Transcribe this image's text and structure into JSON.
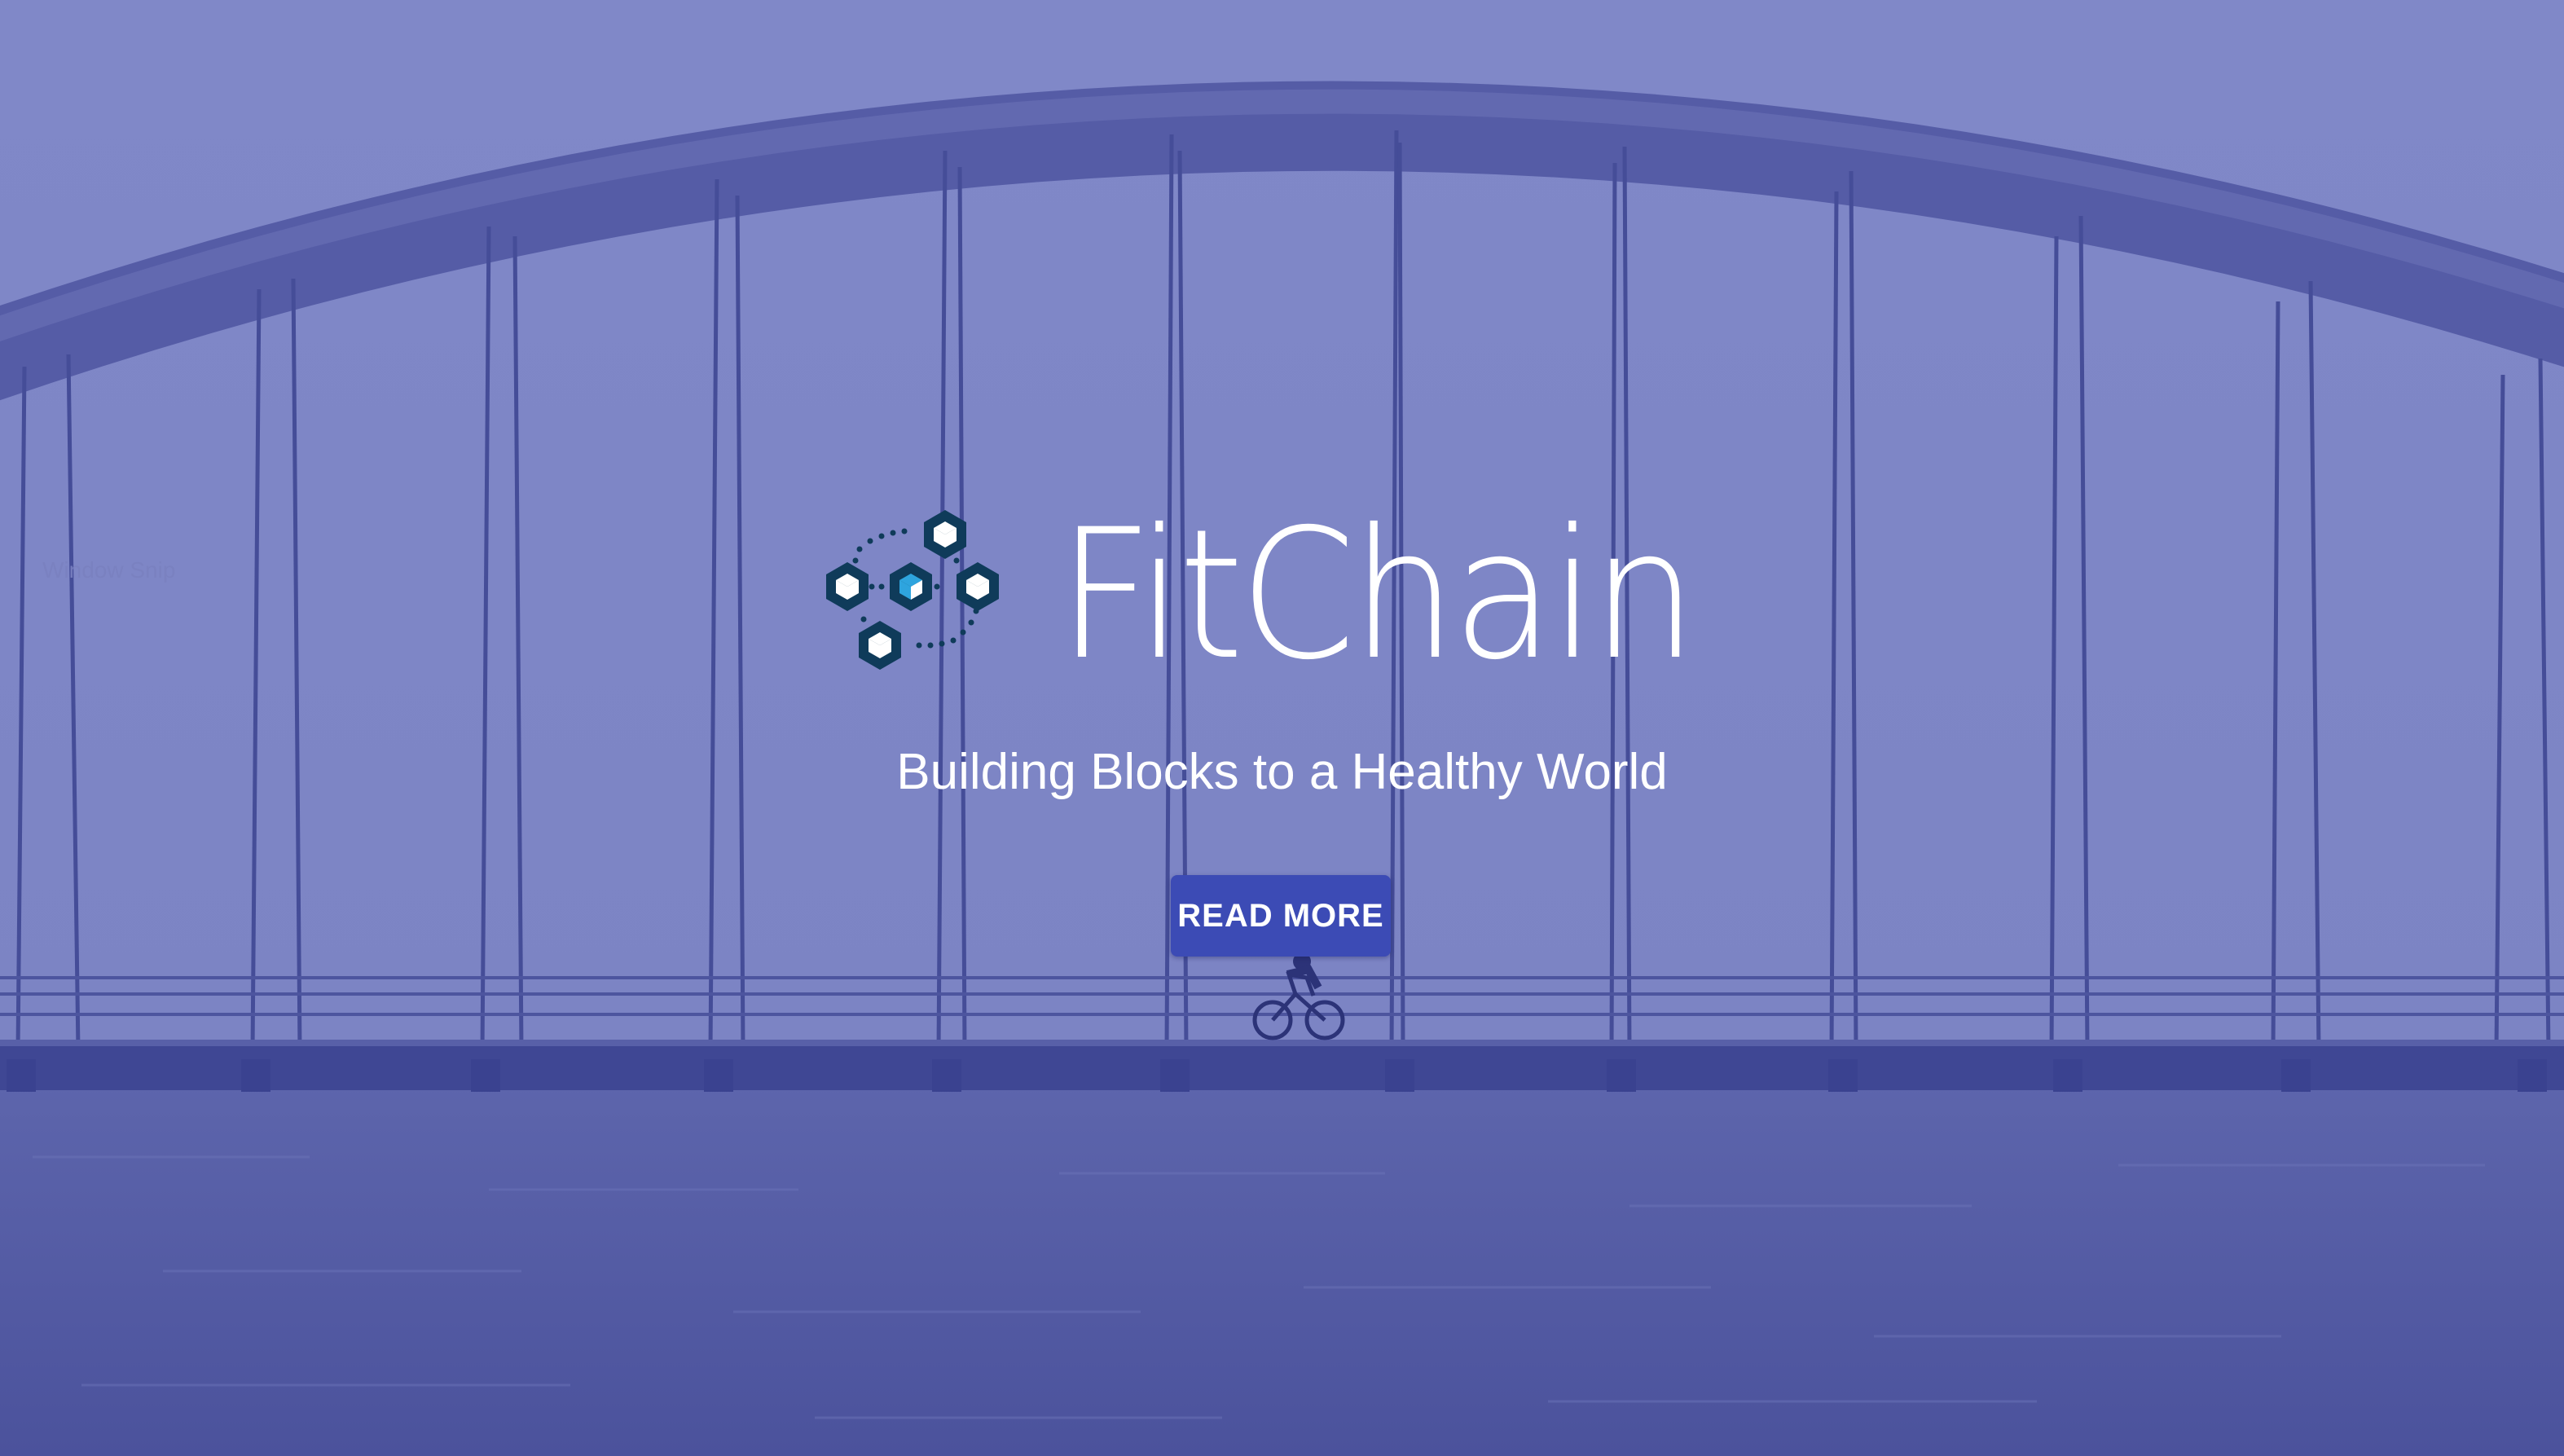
{
  "hero": {
    "overlay_color": "#7f87c6",
    "background_image": "bridge-over-water-photo"
  },
  "ghost_overlay": {
    "label": "Window Snip"
  },
  "brand": {
    "logo_icon": "blockchain-cubes-icon",
    "name": "FitChain",
    "logo_colors": {
      "outline": "#0f3b5a",
      "face_light": "#ffffff",
      "face_accent": "#2ea4de"
    }
  },
  "tagline": "Building Blocks to a Healthy World",
  "cta": {
    "label": "READ MORE",
    "color": "#3c4bb5"
  }
}
